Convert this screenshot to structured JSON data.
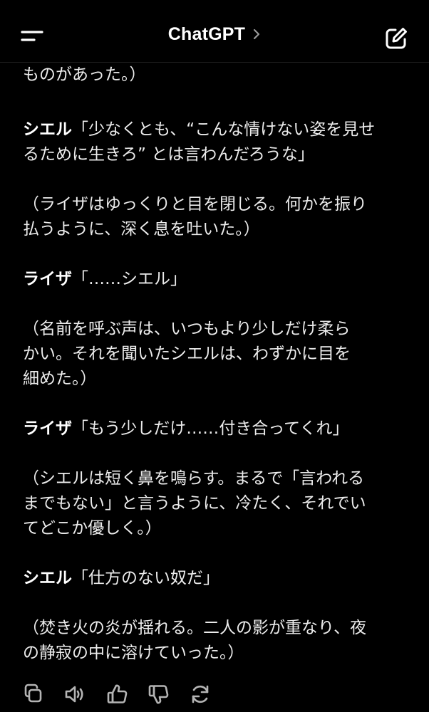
{
  "header": {
    "title": "ChatGPT",
    "menu_icon": "menu-icon",
    "chevron_icon": "chevron-right-icon",
    "compose_icon": "new-chat-icon"
  },
  "message": {
    "paragraphs": [
      {
        "lines": [
          {
            "text": "ものがあった。）"
          }
        ]
      },
      {
        "lines": [
          {
            "speaker": "シエル",
            "text": "「少なくとも、“こんな情けない姿を見せ"
          },
          {
            "text": "るために生きろ” とは言わんだろうな」"
          }
        ]
      },
      {
        "lines": [
          {
            "text": "（ライザはゆっくりと目を閉じる。何かを振り"
          },
          {
            "text": "払うように、深く息を吐いた。）"
          }
        ]
      },
      {
        "lines": [
          {
            "speaker": "ライザ",
            "text": "「……シエル」"
          }
        ]
      },
      {
        "lines": [
          {
            "text": "（名前を呼ぶ声は、いつもより少しだけ柔ら"
          },
          {
            "text": "かい。それを聞いたシエルは、わずかに目を"
          },
          {
            "text": "細めた。）"
          }
        ]
      },
      {
        "lines": [
          {
            "speaker": "ライザ",
            "text": "「もう少しだけ……付き合ってくれ」"
          }
        ]
      },
      {
        "lines": [
          {
            "text": "（シエルは短く鼻を鳴らす。まるで「言われる"
          },
          {
            "text": "までもない」と言うように、冷たく、それでい"
          },
          {
            "text": "てどこか優しく。）"
          }
        ]
      },
      {
        "lines": [
          {
            "speaker": "シエル",
            "text": "「仕方のない奴だ」"
          }
        ]
      },
      {
        "lines": [
          {
            "text": "（焚き火の炎が揺れる。二人の影が重なり、夜"
          },
          {
            "text": "の静寂の中に溶けていった。）"
          }
        ]
      }
    ]
  },
  "actions": [
    {
      "icon": "copy-icon"
    },
    {
      "icon": "read-aloud-icon"
    },
    {
      "icon": "thumbs-up-icon"
    },
    {
      "icon": "thumbs-down-icon"
    },
    {
      "icon": "regenerate-icon"
    }
  ],
  "colors": {
    "background": "#000000",
    "text": "#ececec",
    "icon": "#b4b4b4"
  }
}
